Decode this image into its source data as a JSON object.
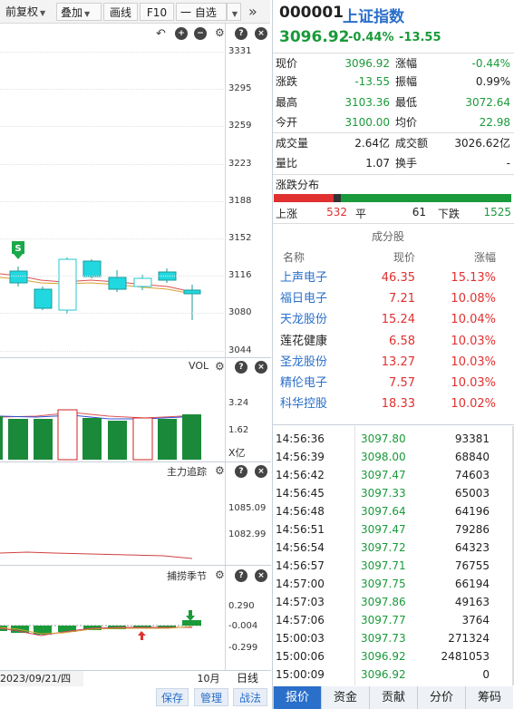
{
  "toolbar": {
    "fq_label": "前复权",
    "overlay_label": "叠加",
    "draw_label": "画线",
    "f10_label": "F10",
    "watchlist_label": "一 自选",
    "expand_icon": "double-chevron-right-icon"
  },
  "kline": {
    "price_ticks": [
      "3331",
      "3295",
      "3259",
      "3223",
      "3188",
      "3152",
      "3116",
      "3080",
      "3044"
    ],
    "marker_s": "S"
  },
  "vol": {
    "title": "VOL",
    "ticks": [
      "3.24",
      "1.62"
    ],
    "unit": "X亿"
  },
  "tracker": {
    "title": "主力追踪",
    "ticks": [
      "1085.09",
      "1082.99"
    ]
  },
  "season": {
    "title": "捕捞季节",
    "ticks": [
      "0.290",
      "-0.004",
      "-0.299"
    ]
  },
  "footer_left": {
    "date": "2023/09/21/四",
    "month_label": "10月",
    "daily_label": "日线",
    "save_label": "保存",
    "manage_label": "管理",
    "tactics_label": "战法"
  },
  "quote": {
    "code": "000001",
    "name": "上证指数",
    "price": "3096.92",
    "change_pct": "-0.44%",
    "change": "-13.55",
    "stats": [
      {
        "l": "现价",
        "lv": "3096.92",
        "r": "涨幅",
        "rv": "-0.44%",
        "lc": "green",
        "rc": "green"
      },
      {
        "l": "涨跌",
        "lv": "-13.55",
        "r": "振幅",
        "rv": "0.99%",
        "lc": "green",
        "rc": "plain"
      },
      {
        "l": "最高",
        "lv": "3103.36",
        "r": "最低",
        "rv": "3072.64",
        "lc": "green",
        "rc": "green"
      },
      {
        "l": "今开",
        "lv": "3100.00",
        "r": "均价",
        "rv": "22.98",
        "lc": "green",
        "rc": "green"
      },
      {
        "l": "成交量",
        "lv": "2.64亿",
        "r": "成交额",
        "rv": "3026.62亿",
        "lc": "plain",
        "rc": "plain"
      },
      {
        "l": "量比",
        "lv": "1.07",
        "r": "换手",
        "rv": "-",
        "lc": "plain",
        "rc": "plain"
      }
    ]
  },
  "distribution": {
    "title": "涨跌分布",
    "up_label": "上涨",
    "up_count": "532",
    "flat_label": "平",
    "flat_count": "61",
    "down_label": "下跌",
    "down_count": "1525",
    "up_color": "#e03030",
    "flat_color": "#333333",
    "down_color": "#1a9a3a"
  },
  "constituents": {
    "title": "成分股",
    "headers": [
      "名称",
      "现价",
      "涨幅"
    ],
    "rows": [
      {
        "name": "上声电子",
        "price": "46.35",
        "pct": "15.13%",
        "name_color": "blue"
      },
      {
        "name": "福日电子",
        "price": "7.21",
        "pct": "10.08%",
        "name_color": "blue"
      },
      {
        "name": "天龙股份",
        "price": "15.24",
        "pct": "10.04%",
        "name_color": "blue"
      },
      {
        "name": "莲花健康",
        "price": "6.58",
        "pct": "10.03%",
        "name_color": "plain"
      },
      {
        "name": "圣龙股份",
        "price": "13.27",
        "pct": "10.03%",
        "name_color": "blue"
      },
      {
        "name": "精伦电子",
        "price": "7.57",
        "pct": "10.03%",
        "name_color": "blue"
      },
      {
        "name": "科华控股",
        "price": "18.33",
        "pct": "10.02%",
        "name_color": "blue"
      }
    ]
  },
  "ticks": [
    {
      "t": "14:56:36",
      "p": "3097.80",
      "v": "93381"
    },
    {
      "t": "14:56:39",
      "p": "3098.00",
      "v": "68840"
    },
    {
      "t": "14:56:42",
      "p": "3097.47",
      "v": "74603"
    },
    {
      "t": "14:56:45",
      "p": "3097.33",
      "v": "65003"
    },
    {
      "t": "14:56:48",
      "p": "3097.64",
      "v": "64196"
    },
    {
      "t": "14:56:51",
      "p": "3097.47",
      "v": "79286"
    },
    {
      "t": "14:56:54",
      "p": "3097.72",
      "v": "64323"
    },
    {
      "t": "14:56:57",
      "p": "3097.71",
      "v": "76755"
    },
    {
      "t": "14:57:00",
      "p": "3097.75",
      "v": "66194"
    },
    {
      "t": "14:57:03",
      "p": "3097.86",
      "v": "49163"
    },
    {
      "t": "14:57:06",
      "p": "3097.77",
      "v": "3764"
    },
    {
      "t": "15:00:03",
      "p": "3097.73",
      "v": "271324"
    },
    {
      "t": "15:00:06",
      "p": "3096.92",
      "v": "2481053"
    },
    {
      "t": "15:00:09",
      "p": "3096.92",
      "v": "0"
    }
  ],
  "tabs": [
    "报价",
    "资金",
    "贡献",
    "分价",
    "筹码"
  ]
}
